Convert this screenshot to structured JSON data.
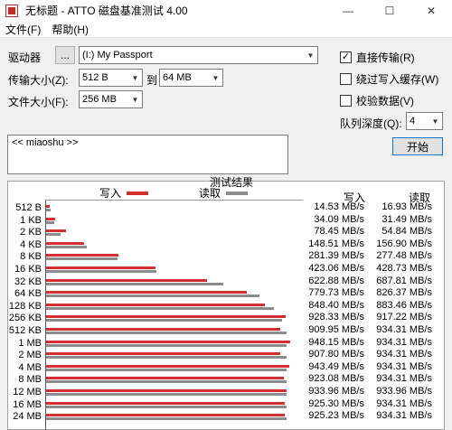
{
  "window": {
    "title": "无标题 - ATTO 磁盘基准测试 4.00",
    "minimize": "—",
    "maximize": "☐",
    "close": "✕"
  },
  "menu": [
    "文件(F)",
    "帮助(H)"
  ],
  "controls": {
    "drive_label": "驱动器",
    "browse_label": "...",
    "drive_value": "(I:) My Passport",
    "transfer_label": "传输大小(Z):",
    "transfer_from": "512 B",
    "to_label": "到",
    "transfer_to": "64 MB",
    "file_label": "文件大小(F):",
    "file_value": "256 MB",
    "direct_io": "直接传输(R)",
    "direct_io_checked": true,
    "bypass_cache": "绕过写入缓存(W)",
    "bypass_checked": false,
    "verify": "校验数据(V)",
    "verify_checked": false,
    "queue_label": "队列深度(Q):",
    "queue_value": "4",
    "start_label": "开始",
    "notes": "<< miaoshu >>"
  },
  "results": {
    "title": "测试结果",
    "write_legend": "写入",
    "read_legend": "读取",
    "write_col": "写入",
    "read_col": "读取",
    "write_color": "#d32f2f",
    "read_color": "#8c8c8c",
    "max_value": 1000
  },
  "chart_data": {
    "type": "bar",
    "categories": [
      "512 B",
      "1 KB",
      "2 KB",
      "4 KB",
      "8 KB",
      "16 KB",
      "32 KB",
      "64 KB",
      "128 KB",
      "256 KB",
      "512 KB",
      "1 MB",
      "2 MB",
      "4 MB",
      "8 MB",
      "12 MB",
      "16 MB",
      "24 MB"
    ],
    "series": [
      {
        "name": "写入",
        "values": [
          14.53,
          34.09,
          78.45,
          148.51,
          281.39,
          423.06,
          622.88,
          779.73,
          848.4,
          928.33,
          909.95,
          948.15,
          907.8,
          943.49,
          923.08,
          933.96,
          925.3,
          925.23
        ]
      },
      {
        "name": "读取",
        "values": [
          16.93,
          31.49,
          54.84,
          156.9,
          277.48,
          428.73,
          687.81,
          826.37,
          883.46,
          917.22,
          934.31,
          934.31,
          934.31,
          934.31,
          934.31,
          933.96,
          934.31,
          934.31
        ]
      }
    ],
    "write_labels": [
      "14.53 MB/s",
      "34.09 MB/s",
      "78.45 MB/s",
      "148.51 MB/s",
      "281.39 MB/s",
      "423.06 MB/s",
      "622.88 MB/s",
      "779.73 MB/s",
      "848.40 MB/s",
      "928.33 MB/s",
      "909.95 MB/s",
      "948.15 MB/s",
      "907.80 MB/s",
      "943.49 MB/s",
      "923.08 MB/s",
      "933.96 MB/s",
      "925.30 MB/s",
      "925.23 MB/s"
    ],
    "read_labels": [
      "16.93 MB/s",
      "31.49 MB/s",
      "54.84 MB/s",
      "156.90 MB/s",
      "277.48 MB/s",
      "428.73 MB/s",
      "687.81 MB/s",
      "826.37 MB/s",
      "883.46 MB/s",
      "917.22 MB/s",
      "934.31 MB/s",
      "934.31 MB/s",
      "934.31 MB/s",
      "934.31 MB/s",
      "934.31 MB/s",
      "933.96 MB/s",
      "934.31 MB/s",
      "934.31 MB/s"
    ]
  }
}
